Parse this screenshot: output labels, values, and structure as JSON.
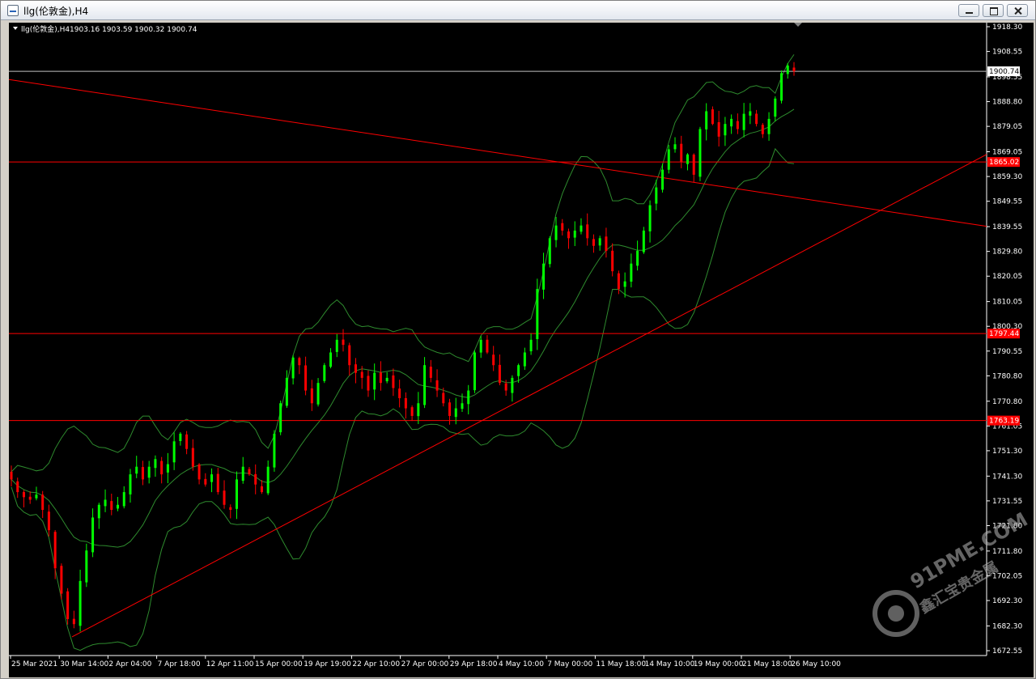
{
  "window": {
    "title": "llg(伦敦金),H4"
  },
  "chart_info": {
    "symbol_label": "llg(伦敦金),H4",
    "ohlc_text": "1903.16 1903.59 1900.32 1900.74"
  },
  "colors": {
    "bull": "#00ff00",
    "bear": "#ff0000",
    "bands": "#2e8b2e",
    "trendline": "#ff0000",
    "level_tag": "#ff0000",
    "price_line": "#c0c0c0"
  },
  "watermark": {
    "text1": "91PME.COM",
    "text2": "鑫汇宝贵金属"
  },
  "chart_data": {
    "type": "candlestick",
    "timeframe": "H4",
    "ylim": [
      1672.55,
      1918.3
    ],
    "y_ticks": [
      "1918.30",
      "1908.55",
      "1898.55",
      "1888.80",
      "1879.05",
      "1869.05",
      "1859.30",
      "1849.55",
      "1839.55",
      "1829.80",
      "1820.05",
      "1810.05",
      "1800.30",
      "1790.55",
      "1780.80",
      "1770.80",
      "1761.05",
      "1751.30",
      "1741.30",
      "1731.55",
      "1721.80",
      "1711.80",
      "1702.05",
      "1692.30",
      "1682.30",
      "1672.55"
    ],
    "x_ticks": [
      "25 Mar 2021",
      "30 Mar 14:00",
      "2 Apr 04:00",
      "7 Apr 18:00",
      "12 Apr 11:00",
      "15 Apr 00:00",
      "19 Apr 19:00",
      "22 Apr 10:00",
      "27 Apr 00:00",
      "29 Apr 18:00",
      "4 May 10:00",
      "7 May 00:00",
      "11 May 18:00",
      "14 May 10:00",
      "19 May 00:00",
      "21 May 18:00",
      "26 May 10:00"
    ],
    "current_price": "1900.74",
    "horizontal_levels": [
      "1865.02",
      "1797.44",
      "1763.19"
    ],
    "trendlines": [
      {
        "name": "resistance",
        "from": {
          "x": "25 Mar 2021",
          "y": 1897.5
        },
        "to": {
          "x": "26 May 10:00+",
          "y": 1839.7
        }
      },
      {
        "name": "support",
        "from": {
          "x": "30 Mar 14:00",
          "y": 1678.0
        },
        "to": {
          "x": "26 May 10:00+",
          "y": 1868.0
        }
      }
    ],
    "candles_close_path": [
      1740,
      1735,
      1733,
      1732,
      1734,
      1728,
      1720,
      1705,
      1695,
      1685,
      1683,
      1700,
      1712,
      1725,
      1730,
      1732,
      1728,
      1730,
      1735,
      1742,
      1745,
      1740,
      1745,
      1748,
      1742,
      1746,
      1755,
      1758,
      1752,
      1745,
      1740,
      1738,
      1742,
      1735,
      1730,
      1728,
      1740,
      1745,
      1742,
      1738,
      1735,
      1745,
      1758,
      1770,
      1780,
      1788,
      1785,
      1775,
      1770,
      1778,
      1785,
      1790,
      1795,
      1793,
      1785,
      1782,
      1780,
      1775,
      1782,
      1778,
      1780,
      1776,
      1772,
      1768,
      1765,
      1770,
      1785,
      1780,
      1775,
      1770,
      1765,
      1768,
      1770,
      1775,
      1790,
      1795,
      1790,
      1785,
      1778,
      1775,
      1780,
      1785,
      1790,
      1795,
      1815,
      1825,
      1835,
      1840,
      1838,
      1835,
      1838,
      1840,
      1835,
      1832,
      1835,
      1830,
      1822,
      1815,
      1818,
      1825,
      1830,
      1838,
      1848,
      1855,
      1862,
      1870,
      1872,
      1865,
      1868,
      1860,
      1878,
      1885,
      1880,
      1875,
      1880,
      1882,
      1878,
      1884,
      1885,
      1880,
      1876,
      1882,
      1890,
      1900,
      1903,
      1900.74
    ]
  }
}
